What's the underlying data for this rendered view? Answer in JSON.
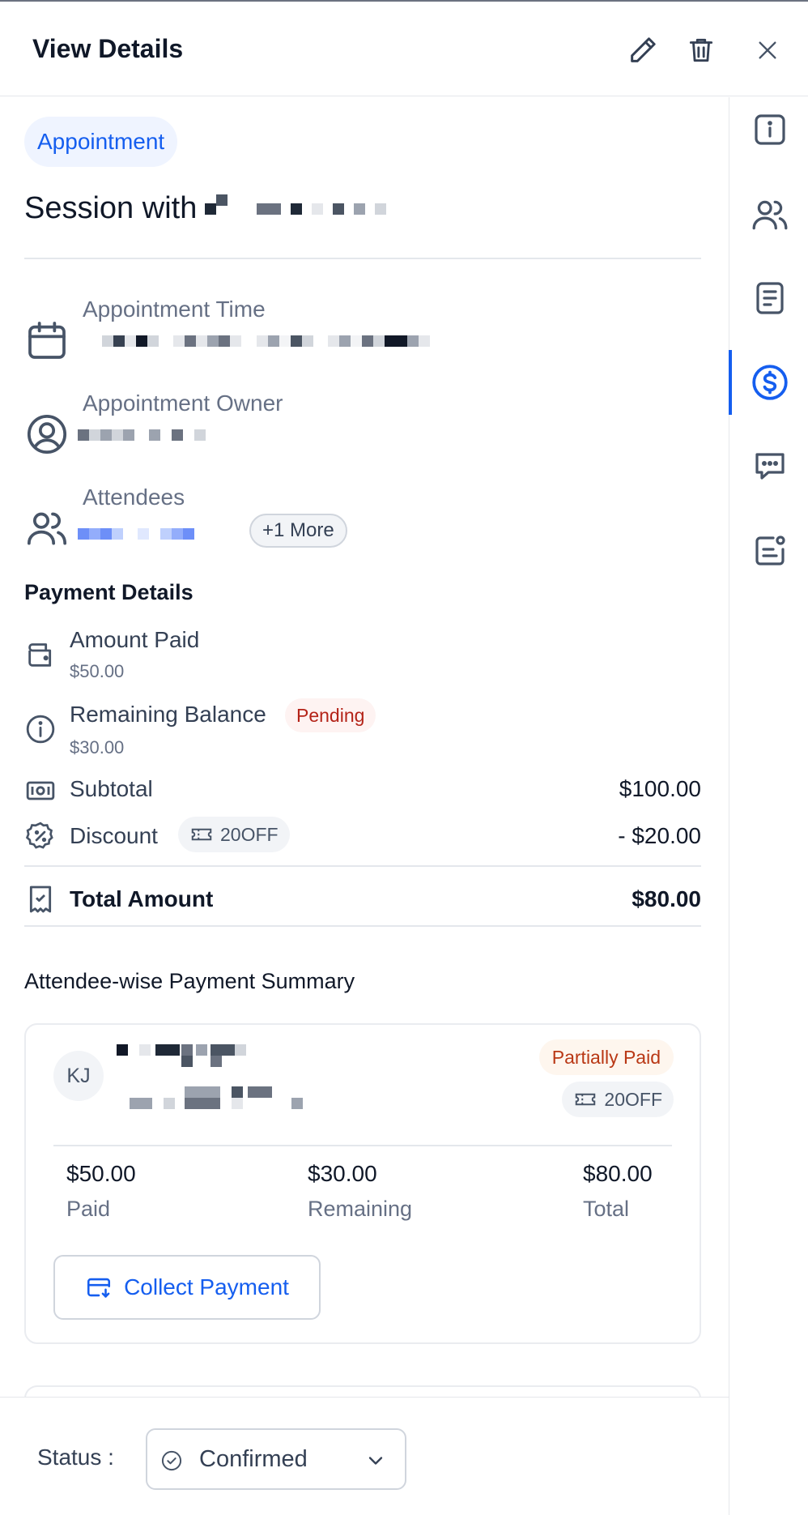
{
  "header": {
    "title": "View Details",
    "icons": [
      "pencil-icon",
      "trash-icon",
      "close-icon"
    ]
  },
  "rail": {
    "items": [
      "info-icon",
      "users-icon",
      "notes-icon",
      "dollar-icon",
      "chat-icon",
      "custom-fields-icon"
    ],
    "active": "dollar-icon"
  },
  "appointment": {
    "type": "Appointment",
    "title_prefix": "Session with"
  },
  "details": {
    "time_label": "Appointment Time",
    "owner_label": "Appointment Owner",
    "attendees_label": "Attendees",
    "more_label": "+1 More"
  },
  "payment": {
    "title": "Payment Details",
    "amount_paid_label": "Amount Paid",
    "amount_paid_value": "$50.00",
    "remaining_label": "Remaining Balance",
    "remaining_value": "$30.00",
    "pending_badge": "Pending",
    "subtotal_label": "Subtotal",
    "subtotal_value": "$100.00",
    "discount_label": "Discount",
    "discount_code": "20OFF",
    "discount_value": "- $20.00",
    "total_label": "Total Amount",
    "total_value": "$80.00"
  },
  "summary": {
    "title": "Attendee-wise Payment Summary",
    "attendee": {
      "initials": "KJ",
      "status_badge": "Partially Paid",
      "coupon": "20OFF",
      "paid_value": "$50.00",
      "paid_label": "Paid",
      "remaining_value": "$30.00",
      "remaining_label": "Remaining",
      "total_value": "$80.00",
      "total_label": "Total",
      "collect_button": "Collect Payment"
    }
  },
  "footer": {
    "status_label": "Status :",
    "status_value": "Confirmed"
  },
  "colors": {
    "accent": "#155eef",
    "pending": "#b42318",
    "partial": "#b93815",
    "text_primary": "#101828",
    "text_muted": "#667085"
  }
}
